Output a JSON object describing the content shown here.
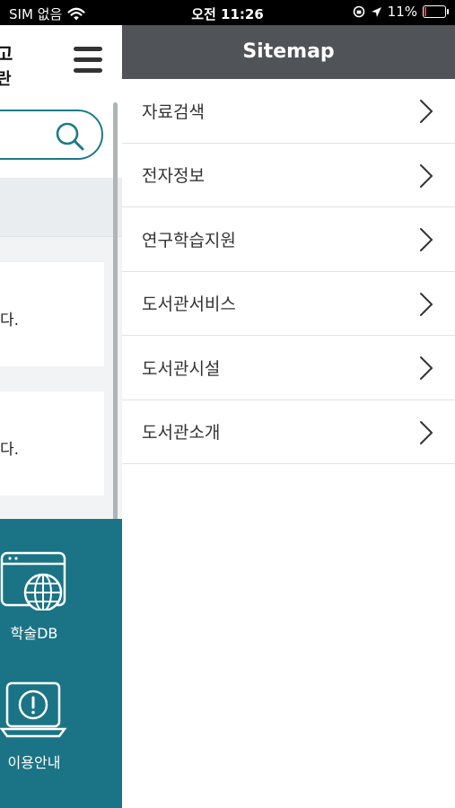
{
  "status_bar": {
    "carrier": "SIM 없음",
    "time": "오전 11:26",
    "battery_percent": "11%"
  },
  "background_page": {
    "title_line1": "고",
    "title_line2": "란",
    "notice1_text": "다.",
    "notice2_text": "다.",
    "quick_links": [
      {
        "label": "학술DB",
        "icon": "globe-window-icon"
      },
      {
        "label": "이용안내",
        "icon": "exclamation-laptop-icon"
      }
    ],
    "accent_color": "#1a7485"
  },
  "sitemap": {
    "title": "Sitemap",
    "items": [
      {
        "label": "자료검색"
      },
      {
        "label": "전자정보"
      },
      {
        "label": "연구학습지원"
      },
      {
        "label": "도서관서비스"
      },
      {
        "label": "도서관시설"
      },
      {
        "label": "도서관소개"
      }
    ],
    "header_color": "#505357"
  }
}
